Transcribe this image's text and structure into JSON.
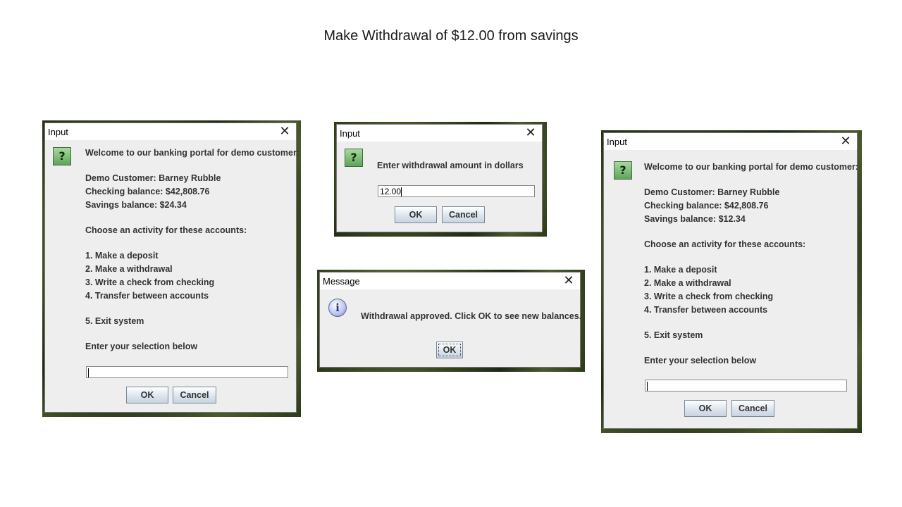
{
  "slide": {
    "title": "Make Withdrawal of $12.00 from savings"
  },
  "dialog_menu_before": {
    "title": "Input",
    "close_label": "✕",
    "icon_glyph": "?",
    "lines": [
      "Welcome to our banking portal for demo customer:",
      "Demo Customer:  Barney Rubble",
      "Checking balance: $42,808.76",
      "Savings balance:  $24.34",
      "Choose an activity for these accounts:",
      "1.  Make a deposit",
      "2.  Make a withdrawal",
      "3.  Write a check from checking",
      "4.  Transfer between accounts",
      "5.  Exit system",
      "Enter your selection below"
    ],
    "input_value": "",
    "ok_label": "OK",
    "cancel_label": "Cancel"
  },
  "dialog_amount": {
    "title": "Input",
    "close_label": "✕",
    "icon_glyph": "?",
    "prompt": "Enter withdrawal amount in dollars",
    "input_value": "12.00",
    "ok_label": "OK",
    "cancel_label": "Cancel"
  },
  "dialog_message": {
    "title": "Message",
    "close_label": "✕",
    "icon_glyph": "i",
    "text": "Withdrawal approved.  Click OK to see new balances.",
    "ok_label": "OK"
  },
  "dialog_menu_after": {
    "title": "Input",
    "close_label": "✕",
    "icon_glyph": "?",
    "lines": [
      "Welcome to our banking portal for demo customer:",
      "Demo Customer:  Barney Rubble",
      "Checking balance: $42,808.76",
      "Savings balance:  $12.34",
      "Choose an activity for these accounts:",
      "1.  Make a deposit",
      "2.  Make a withdrawal",
      "3.  Write a check from checking",
      "4.  Transfer between accounts",
      "5.  Exit system",
      "Enter your selection below"
    ],
    "input_value": "",
    "ok_label": "OK",
    "cancel_label": "Cancel"
  }
}
